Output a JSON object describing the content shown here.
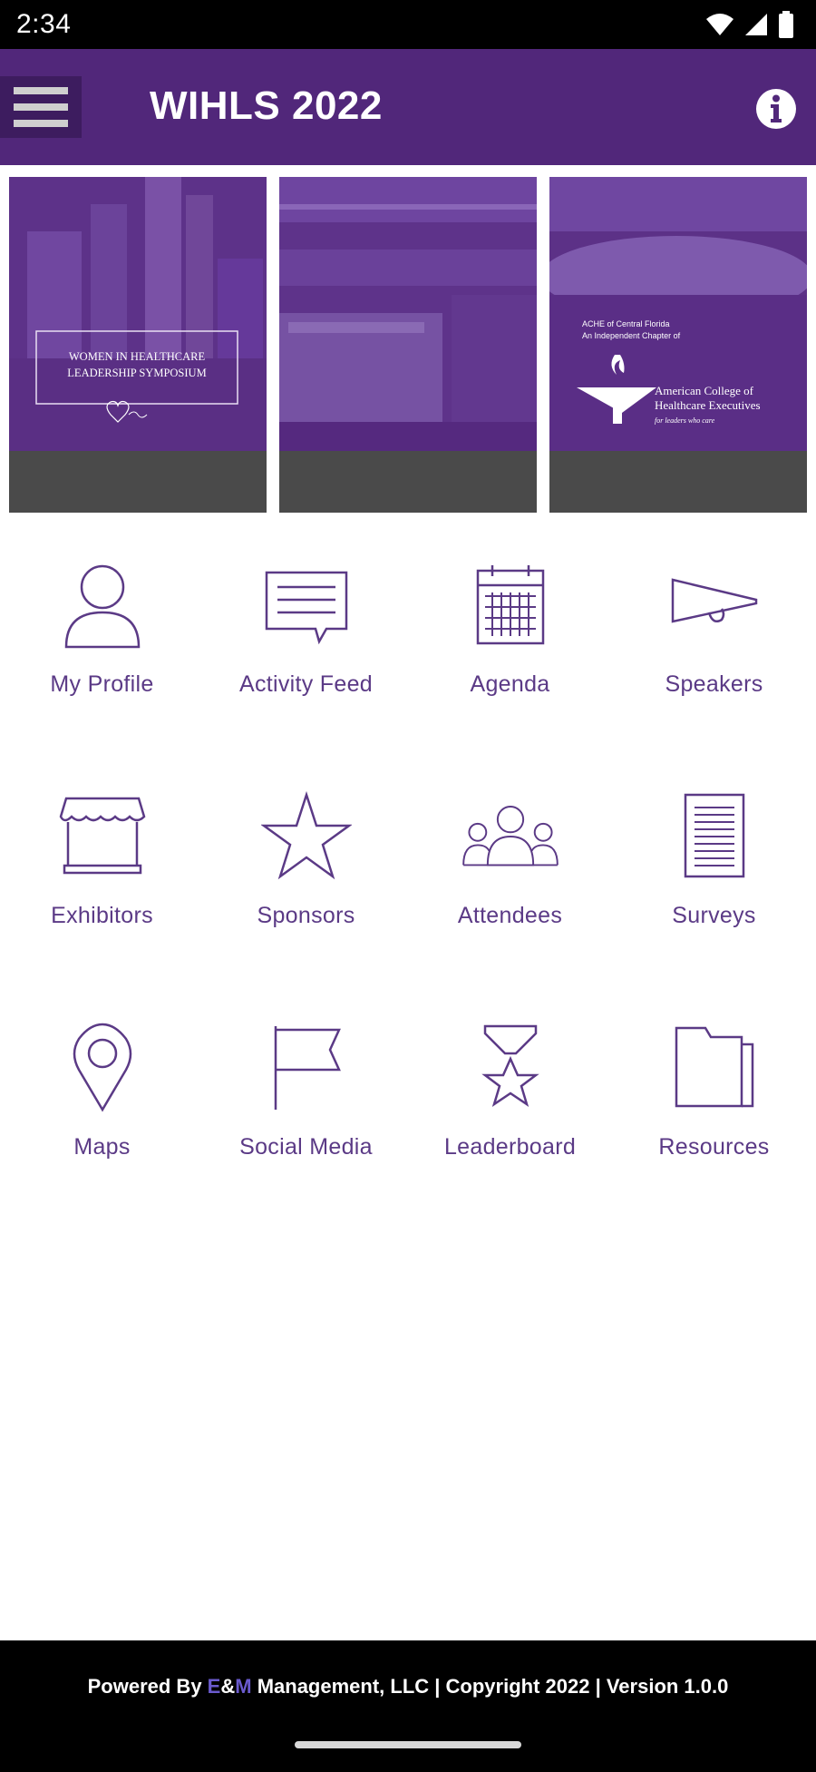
{
  "status_bar": {
    "time": "2:34",
    "icons": [
      "wifi-icon",
      "cell-signal-icon",
      "battery-icon"
    ]
  },
  "app_bar": {
    "title": "WIHLS 2022",
    "menu_icon": "hamburger-menu-icon",
    "info_icon": "info-icon",
    "color": "#51277a"
  },
  "banners": [
    {
      "line1": "WOMEN IN HEALTHCARE",
      "line2": "LEADERSHIP SYMPOSIUM",
      "caption": ""
    },
    {
      "caption": ""
    },
    {
      "small_line1": "ACHE of Central Florida",
      "small_line2": "An Independent Chapter of",
      "org_line1": "American College of",
      "org_line2": "Healthcare Executives",
      "tagline": "for leaders who care",
      "caption": ""
    }
  ],
  "grid": {
    "accent": "#5b3a86",
    "items": [
      {
        "label": "My Profile",
        "icon": "user-profile-icon"
      },
      {
        "label": "Activity Feed",
        "icon": "chat-bubble-icon"
      },
      {
        "label": "Agenda",
        "icon": "calendar-icon"
      },
      {
        "label": "Speakers",
        "icon": "megaphone-icon"
      },
      {
        "label": "Exhibitors",
        "icon": "storefront-icon"
      },
      {
        "label": "Sponsors",
        "icon": "star-icon"
      },
      {
        "label": "Attendees",
        "icon": "group-icon"
      },
      {
        "label": "Surveys",
        "icon": "document-icon"
      },
      {
        "label": "Maps",
        "icon": "map-pin-icon"
      },
      {
        "label": "Social Media",
        "icon": "flag-icon"
      },
      {
        "label": "Leaderboard",
        "icon": "medal-icon"
      },
      {
        "label": "Resources",
        "icon": "folder-icon"
      }
    ]
  },
  "footer": {
    "powered_by": "Powered By ",
    "brand_e": "E",
    "brand_amp": "&",
    "brand_m": "M",
    "rest": " Management, LLC | Copyright 2022 | Version 1.0.0"
  }
}
